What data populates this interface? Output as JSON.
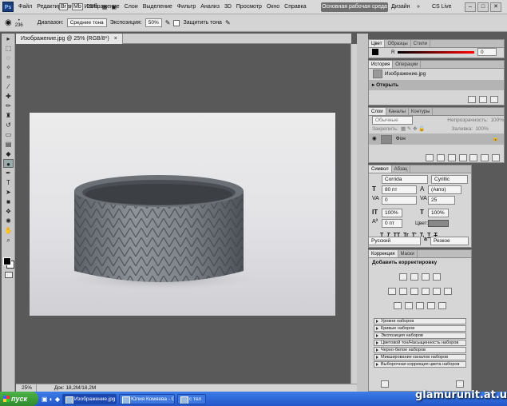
{
  "menubar": {
    "app_logo": "Ps",
    "items": [
      "Файл",
      "Редактирование",
      "Изображение",
      "Слои",
      "Выделение",
      "Фильтр",
      "Анализ",
      "3D",
      "Просмотр",
      "Окно",
      "Справка"
    ],
    "zoom": "25%",
    "workspace_main": "Основная рабочая среда",
    "workspace_design": "Дизайн",
    "workspace_more": "»",
    "cs_live": "CS Live"
  },
  "options": {
    "brush_size": "236",
    "range_label": "Диапазон:",
    "range_value": "Средние тона",
    "exposure_label": "Экспозиция:",
    "exposure_value": "50%",
    "protect_label": "Защитить тона"
  },
  "document": {
    "tab_title": "Изображение.jpg @ 25% (RGB/8*)",
    "status_zoom": "25%",
    "status_doc": "Док: 18,2M/18,2M"
  },
  "color_panel": {
    "tabs": [
      "Цвет",
      "Образцы",
      "Стили"
    ],
    "channel": "R",
    "channel_value": "0"
  },
  "history_panel": {
    "tabs": [
      "История",
      "Операции"
    ],
    "snapshot": "Изображение.jpg",
    "step": "Открыть"
  },
  "layers_panel": {
    "tabs": [
      "Слои",
      "Каналы",
      "Контуры"
    ],
    "blend_mode": "Обычные",
    "opacity_label": "Непрозрачность:",
    "opacity_value": "100%",
    "lock_label": "Закрепить:",
    "fill_label": "Заливка:",
    "fill_value": "100%",
    "layer_name": "Фон"
  },
  "character_panel": {
    "tabs": [
      "Символ",
      "Абзац"
    ],
    "font_family": "Corrida",
    "font_style": "Cyrillic",
    "font_size": "80 пт",
    "leading": "(Авто)",
    "kerning": "0",
    "tracking": "25",
    "vscale": "100%",
    "hscale": "100%",
    "baseline": "0 пт",
    "color_label": "Цвет:",
    "style_buttons": [
      "T",
      "T",
      "TT",
      "Tr",
      "T'",
      "T,",
      "T",
      "T"
    ],
    "language": "Русский",
    "antialias_label": "a",
    "antialias_value": "Резкое"
  },
  "adjustments_panel": {
    "tabs": [
      "Коррекция",
      "Маски"
    ],
    "title": "Добавить корректировку",
    "presets": [
      "Уровни наборов",
      "Кривые наборов",
      "Экспозиция наборов",
      "Цветовой тон/Насыщенность наборов",
      "Черно-белое наборов",
      "Микширование каналов наборов",
      "Выборочная коррекция цвета наборов"
    ]
  },
  "taskbar": {
    "start": "пуск",
    "tasks": [
      "Изображение.jpg @ 25...",
      "Юлия Комяева - Goo...",
      "с тел"
    ]
  },
  "watermark": "glamurunit.at.ua"
}
